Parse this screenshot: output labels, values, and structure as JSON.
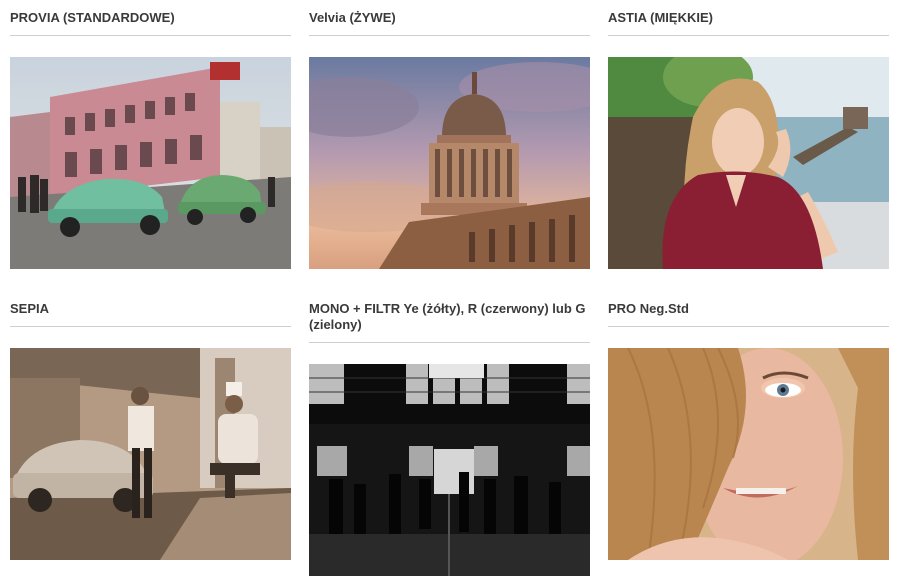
{
  "gallery": {
    "items": [
      {
        "title": "PROVIA (STANDARDOWE)",
        "image": "havana-street-classic-cars-photo"
      },
      {
        "title": "Velvia (ŻYWE)",
        "image": "capitol-dome-sunset-photo"
      },
      {
        "title": "ASTIA (MIĘKKIE)",
        "image": "woman-seaside-portrait-photo"
      },
      {
        "title": "SEPIA",
        "image": "sepia-street-car-men-photo"
      },
      {
        "title": "MONO + FILTR Ye (żółty), R (czerwony) lub G (zielony)",
        "image": "monochrome-station-hall-photo"
      },
      {
        "title": "PRO Neg.Std",
        "image": "woman-face-closeup-photo"
      }
    ]
  }
}
